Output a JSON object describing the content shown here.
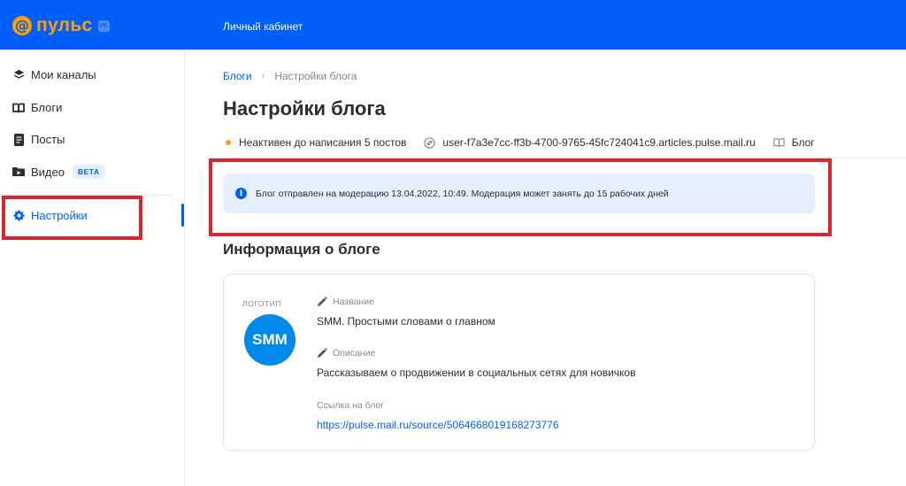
{
  "brand": {
    "name": "пульс",
    "at_symbol": "@",
    "vk_badge": "VK"
  },
  "header": {
    "nav_label": "Личный кабинет"
  },
  "sidebar": {
    "items": [
      {
        "label": "Мои каналы",
        "icon": "layers-icon"
      },
      {
        "label": "Блоги",
        "icon": "book-icon"
      },
      {
        "label": "Посты",
        "icon": "document-icon"
      },
      {
        "label": "Видео",
        "icon": "video-icon",
        "badge": "BETA"
      },
      {
        "label": "Настройки",
        "icon": "gear-icon",
        "active": true
      }
    ]
  },
  "breadcrumb": {
    "parent": "Блоги",
    "separator": "›",
    "current": "Настройки блога"
  },
  "page": {
    "title": "Настройки блога"
  },
  "meta": {
    "status": "Неактивен до написания 5 постов",
    "domain": "user-f7a3e7cc-ff3b-4700-9765-45fc724041c9.articles.pulse.mail.ru",
    "type": "Блог"
  },
  "alert": {
    "icon_text": "i",
    "text": "Блог отправлен на модерацию 13.04.2022, 10:49. Модерация может занять до 15 рабочих дней"
  },
  "info": {
    "section_title": "Информация о блоге",
    "logo_label": "ЛОГОТИП",
    "avatar_text": "SMM",
    "name_label": "Название",
    "name_value": "SMM. Простыми словами о главном",
    "description_label": "Описание",
    "description_value": "Рассказываем о продвижении в социальных сетях для новичков",
    "link_label": "Ссылка на блог",
    "link_value": "https://pulse.mail.ru/source/5064668019168273776"
  },
  "colors": {
    "brand_blue": "#005ff9",
    "brand_orange": "#ff9e00",
    "highlight_red": "#d9252e",
    "alert_bg": "#e5efff"
  }
}
